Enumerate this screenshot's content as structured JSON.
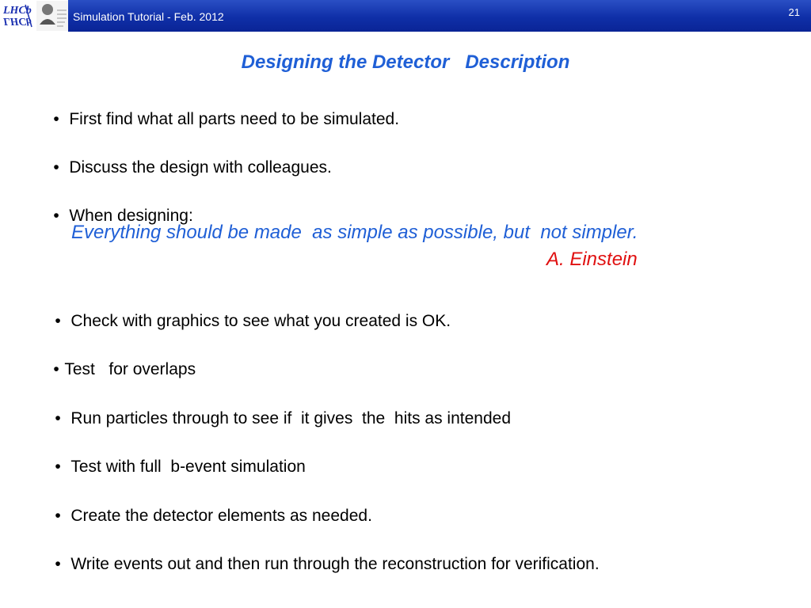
{
  "header": {
    "title": "Simulation Tutorial - Feb. 2012",
    "page_number": "21",
    "logo_text": "LHCb"
  },
  "slide": {
    "title": "Designing the Detector   Description",
    "bullets_top": [
      "First find what all parts need to be simulated.",
      "Discuss the design with colleagues.",
      "When designing:"
    ],
    "quote": "Everything should be made  as simple as possible, but  not simpler.",
    "quote_author": "A. Einstein",
    "bullets_bottom": [
      "Check with graphics to see what you created is OK.",
      "Test   for overlaps",
      "Run particles through to see if  it gives  the  hits as intended",
      "Test with full  b-event simulation",
      "Create the detector elements as needed.",
      "Write events out and then run through the reconstruction for verification."
    ],
    "bullet_symbol": "•"
  },
  "colors": {
    "header_blue": "#0f2fa8",
    "title_blue": "#1f5fd6",
    "quote_blue": "#1f5fd6",
    "author_red": "#e01010"
  }
}
